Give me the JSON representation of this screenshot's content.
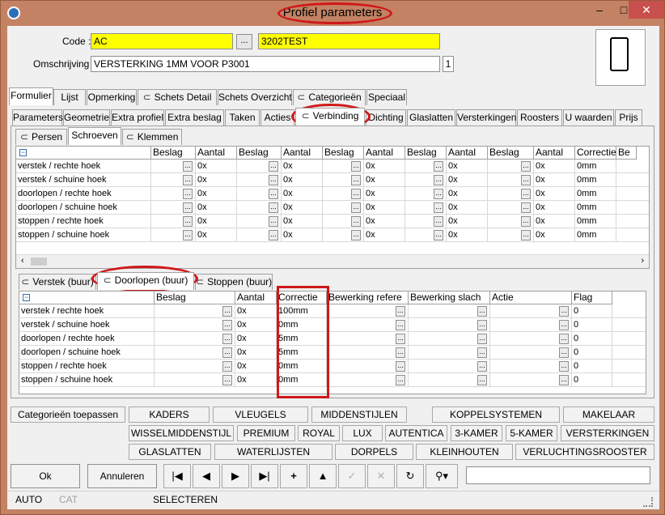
{
  "window": {
    "title": "Profiel parameters",
    "minimize": "–",
    "maximize": "□",
    "close": "✕"
  },
  "header": {
    "code_label": "Code :",
    "code_value": "AC",
    "code_browse": "...",
    "code_desc": "3202TEST",
    "omschrijving_label": "Omschrijving :",
    "omschrijving_value": "VERSTERKING 1MM VOOR P3001",
    "count": "1"
  },
  "main_tabs": [
    "Formulier",
    "Lijst",
    "Opmerking",
    "Schets Detail",
    "Schets Overzicht",
    "Categorieën",
    "Speciaal"
  ],
  "sub_tabs": [
    "Parameters",
    "Geometrie",
    "Extra profiel",
    "Extra beslag",
    "Taken",
    "Acties",
    "Verbinding",
    "Dichting",
    "Glaslatten",
    "Versterkingen",
    "Roosters",
    "U waarden",
    "Prijs"
  ],
  "verb_tabs": [
    "Persen",
    "Schroeven",
    "Klemmen"
  ],
  "grid1": {
    "headers": [
      "Beslag",
      "Aantal",
      "Beslag",
      "Aantal",
      "Beslag",
      "Aantal",
      "Beslag",
      "Aantal",
      "Beslag",
      "Aantal",
      "Correctie",
      "Be"
    ],
    "rows": [
      {
        "label": "verstek / rechte hoek",
        "aantal": "0x",
        "correctie": "0mm"
      },
      {
        "label": "verstek / schuine hoek",
        "aantal": "0x",
        "correctie": "0mm"
      },
      {
        "label": "doorlopen / rechte hoek",
        "aantal": "0x",
        "correctie": "0mm"
      },
      {
        "label": "doorlopen / schuine hoek",
        "aantal": "0x",
        "correctie": "0mm"
      },
      {
        "label": "stoppen / rechte hoek",
        "aantal": "0x",
        "correctie": "0mm"
      },
      {
        "label": "stoppen / schuine hoek",
        "aantal": "0x",
        "correctie": "0mm"
      }
    ]
  },
  "lower_tabs": [
    "Verstek (buur)",
    "Doorlopen (buur)",
    "Stoppen (buur)"
  ],
  "grid2": {
    "headers": [
      "Beslag",
      "Aantal",
      "Correctie",
      "Bewerking refere",
      "Bewerking slach",
      "Actie",
      "Flag"
    ],
    "rows": [
      {
        "label": "verstek / rechte hoek",
        "aantal": "0x",
        "correctie": "100mm",
        "flag": "0"
      },
      {
        "label": "verstek / schuine hoek",
        "aantal": "0x",
        "correctie": "0mm",
        "flag": "0"
      },
      {
        "label": "doorlopen / rechte hoek",
        "aantal": "0x",
        "correctie": "5mm",
        "flag": "0"
      },
      {
        "label": "doorlopen / schuine hoek",
        "aantal": "0x",
        "correctie": "5mm",
        "flag": "0"
      },
      {
        "label": "stoppen / rechte hoek",
        "aantal": "0x",
        "correctie": "0mm",
        "flag": "0"
      },
      {
        "label": "stoppen / schuine hoek",
        "aantal": "0x",
        "correctie": "0mm",
        "flag": "0"
      }
    ]
  },
  "cat_apply": "Categorieën toepassen",
  "cat_buttons": [
    [
      "KADERS",
      "VLEUGELS",
      "MIDDENSTIJLEN",
      "KOPPELSYSTEMEN",
      "MAKELAAR"
    ],
    [
      "WISSELMIDDENSTIJL",
      "PREMIUM",
      "ROYAL",
      "LUX",
      "AUTENTICA",
      "3-KAMER",
      "5-KAMER",
      "VERSTERKINGEN"
    ],
    [
      "GLASLATTEN",
      "WATERLIJSTEN",
      "DORPELS",
      "KLEINHOUTEN",
      "VERLUCHTINGSROOSTER"
    ]
  ],
  "footer": {
    "ok": "Ok",
    "annuleren": "Annuleren",
    "search": ""
  },
  "status": {
    "mode": "AUTO",
    "cat": "CAT",
    "action": "SELECTEREN"
  },
  "colors": {
    "title_bar": "#c38263",
    "highlight": "#ffff00",
    "annotation": "#d01818"
  }
}
